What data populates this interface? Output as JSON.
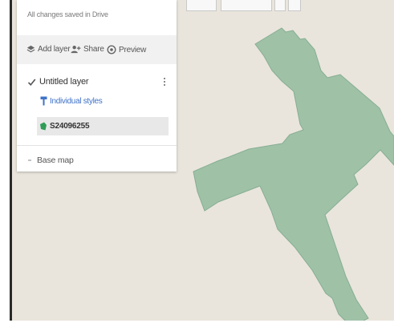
{
  "panel": {
    "status": "All changes saved in Drive",
    "actions": {
      "add_layer": "Add layer",
      "share": "Share",
      "preview": "Preview"
    },
    "layer": {
      "title": "Untitled layer",
      "styles_link": "Individual styles",
      "feature_label": "S24096255"
    },
    "base_map": "Base map"
  },
  "colors": {
    "map_background": "#e9e5dc",
    "polygon_fill": "#9fc2a7",
    "link": "#3f72c9",
    "feature_icon": "#2f9d57"
  },
  "icons": [
    "add-layer-icon",
    "share-icon",
    "preview-icon",
    "checkbox-icon",
    "more-vert-icon",
    "paint-roller-icon",
    "polygon-feature-icon",
    "chevron-icon"
  ]
}
